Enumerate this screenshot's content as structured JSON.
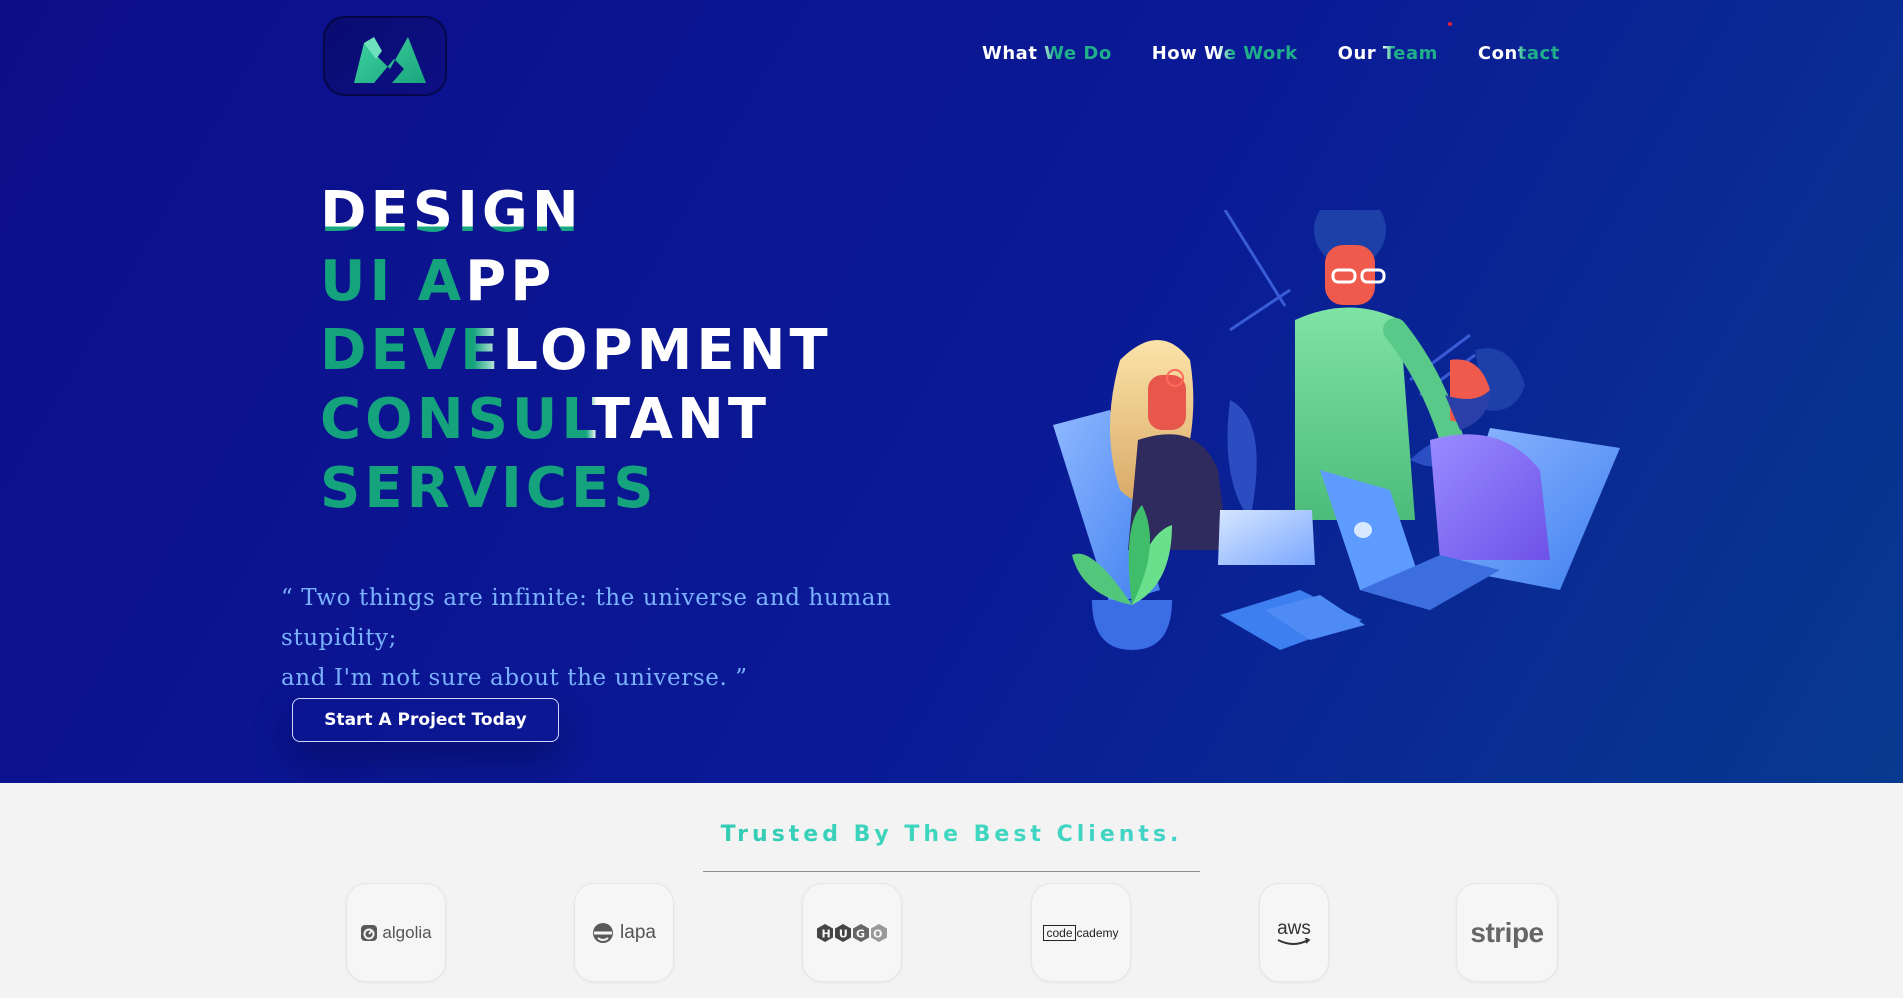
{
  "nav": {
    "items": [
      {
        "label": "What We Do"
      },
      {
        "label": "How We Work"
      },
      {
        "label": "Our Team"
      },
      {
        "label": "Contact"
      }
    ]
  },
  "hero": {
    "headline": [
      "DESIGN",
      "UI APP",
      "DEVELOPMENT",
      "CONSULTANT",
      "SERVICES"
    ],
    "quote_line1": "“ Two things are infinite: the universe and human stupidity;",
    "quote_line2": "and I'm not sure about the universe. ”",
    "cta_label": "Start A Project Today"
  },
  "clients": {
    "heading": "Trusted By The Best Clients.",
    "logos": [
      {
        "name": "algolia"
      },
      {
        "name": "lapa"
      },
      {
        "name": "HUGO"
      },
      {
        "name": "codecademy",
        "name_prefix": "code",
        "name_suffix": "cademy"
      },
      {
        "name": "aws"
      },
      {
        "name": "stripe"
      }
    ]
  },
  "colors": {
    "hero_bg": "#0d0e8a",
    "accent_green": "#15a37e",
    "quote_blue": "#7bb2ff",
    "page_bg": "#f3f3f3"
  },
  "icons": {
    "logo": "brand-logo-icon",
    "algolia": "algolia-icon",
    "lapa": "lapa-icon",
    "aws": "aws-smile-icon"
  }
}
